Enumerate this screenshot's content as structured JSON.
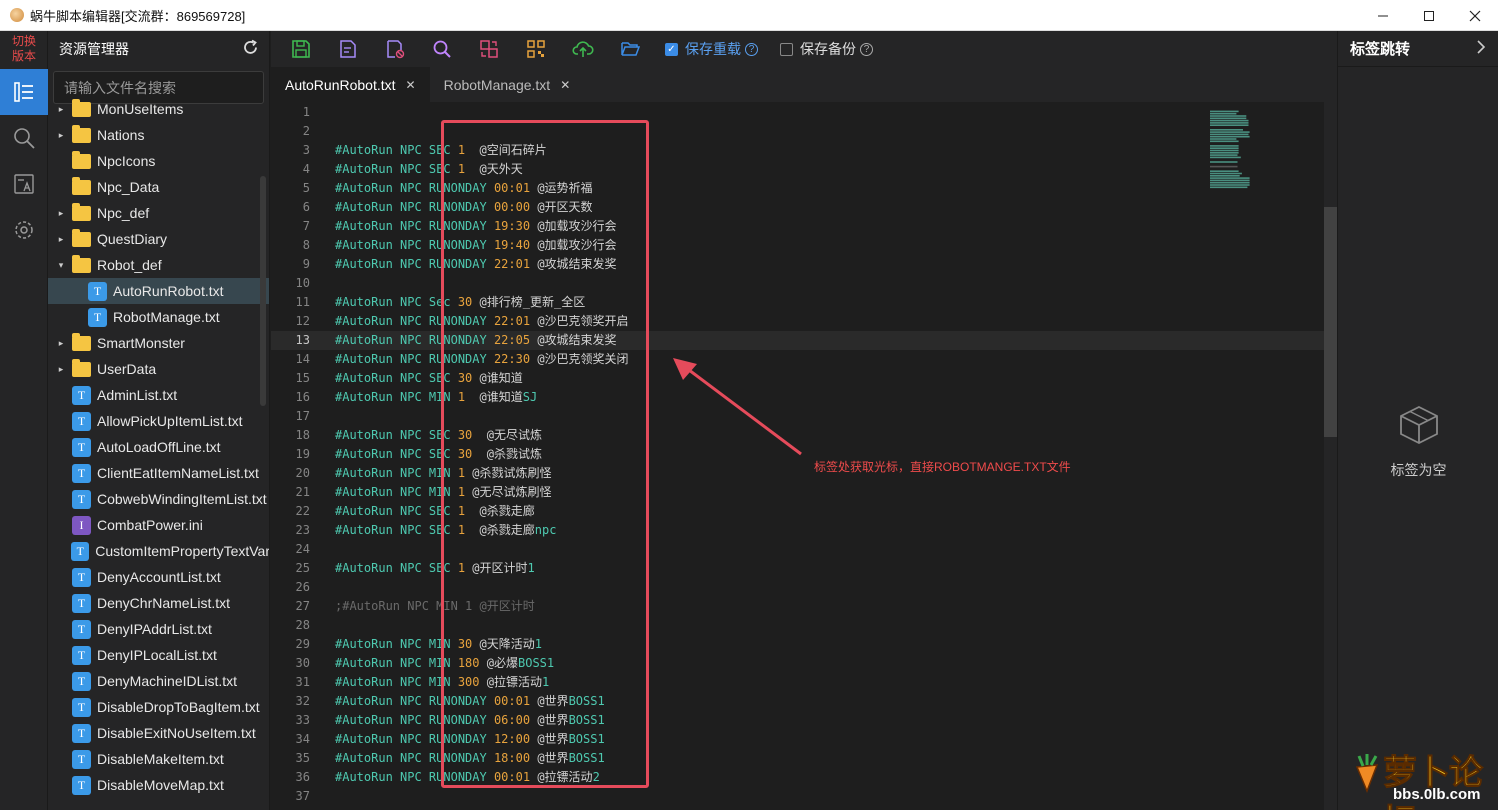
{
  "window": {
    "title": "蜗牛脚本编辑器[交流群：869569728]"
  },
  "activity": {
    "switch_version": "切换\n版本",
    "icons": [
      "explorer-icon",
      "search-icon",
      "font-replace-icon",
      "settings-icon"
    ]
  },
  "explorer": {
    "title": "资源管理器",
    "search_placeholder": "请输入文件名搜索",
    "items": [
      {
        "label": "MonUseItems",
        "type": "folder",
        "arrow": "▸",
        "depth": 0
      },
      {
        "label": "Nations",
        "type": "folder",
        "arrow": "▸",
        "depth": 0
      },
      {
        "label": "NpcIcons",
        "type": "folder",
        "arrow": "",
        "depth": 0
      },
      {
        "label": "Npc_Data",
        "type": "folder",
        "arrow": "",
        "depth": 0
      },
      {
        "label": "Npc_def",
        "type": "folder",
        "arrow": "▸",
        "depth": 0
      },
      {
        "label": "QuestDiary",
        "type": "folder",
        "arrow": "▸",
        "depth": 0
      },
      {
        "label": "Robot_def",
        "type": "folder",
        "arrow": "▾",
        "depth": 0
      },
      {
        "label": "AutoRunRobot.txt",
        "type": "txt",
        "arrow": "",
        "depth": 1,
        "selected": true
      },
      {
        "label": "RobotManage.txt",
        "type": "txt",
        "arrow": "",
        "depth": 1
      },
      {
        "label": "SmartMonster",
        "type": "folder",
        "arrow": "▸",
        "depth": 0
      },
      {
        "label": "UserData",
        "type": "folder",
        "arrow": "▸",
        "depth": 0
      },
      {
        "label": "AdminList.txt",
        "type": "txt",
        "arrow": "",
        "depth": 0
      },
      {
        "label": "AllowPickUpItemList.txt",
        "type": "txt",
        "arrow": "",
        "depth": 0
      },
      {
        "label": "AutoLoadOffLine.txt",
        "type": "txt",
        "arrow": "",
        "depth": 0
      },
      {
        "label": "ClientEatItemNameList.txt",
        "type": "txt",
        "arrow": "",
        "depth": 0
      },
      {
        "label": "CobwebWindingItemList.txt",
        "type": "txt",
        "arrow": "",
        "depth": 0
      },
      {
        "label": "CombatPower.ini",
        "type": "ini",
        "arrow": "",
        "depth": 0
      },
      {
        "label": "CustomItemPropertyTextVar",
        "type": "txt",
        "arrow": "",
        "depth": 0
      },
      {
        "label": "DenyAccountList.txt",
        "type": "txt",
        "arrow": "",
        "depth": 0
      },
      {
        "label": "DenyChrNameList.txt",
        "type": "txt",
        "arrow": "",
        "depth": 0
      },
      {
        "label": "DenyIPAddrList.txt",
        "type": "txt",
        "arrow": "",
        "depth": 0
      },
      {
        "label": "DenyIPLocalList.txt",
        "type": "txt",
        "arrow": "",
        "depth": 0
      },
      {
        "label": "DenyMachineIDList.txt",
        "type": "txt",
        "arrow": "",
        "depth": 0
      },
      {
        "label": "DisableDropToBagItem.txt",
        "type": "txt",
        "arrow": "",
        "depth": 0
      },
      {
        "label": "DisableExitNoUseItem.txt",
        "type": "txt",
        "arrow": "",
        "depth": 0
      },
      {
        "label": "DisableMakeItem.txt",
        "type": "txt",
        "arrow": "",
        "depth": 0
      },
      {
        "label": "DisableMoveMap.txt",
        "type": "txt",
        "arrow": "",
        "depth": 0
      }
    ]
  },
  "toolbar": {
    "buttons": [
      {
        "name": "save-icon",
        "color": "#3fb950"
      },
      {
        "name": "edit-file-icon",
        "color": "#a78bfa"
      },
      {
        "name": "file-close-icon",
        "color": "#a78bfa"
      },
      {
        "name": "search-icon",
        "color": "#c084fc"
      },
      {
        "name": "replace-icon",
        "color": "#e04f7c"
      },
      {
        "name": "qr-code-icon",
        "color": "#e8a33d"
      },
      {
        "name": "cloud-upload-icon",
        "color": "#3fb950"
      },
      {
        "name": "folder-open-icon",
        "color": "#3b8ce6"
      }
    ],
    "save_reload": {
      "label": "保存重载",
      "checked": true
    },
    "save_backup": {
      "label": "保存备份",
      "checked": false
    }
  },
  "tabs": [
    {
      "label": "AutoRunRobot.txt",
      "active": true
    },
    {
      "label": "RobotManage.txt",
      "active": false
    }
  ],
  "editor": {
    "current_line": 13,
    "lines": [
      {
        "n": "1",
        "t": ""
      },
      {
        "n": "2",
        "t": ""
      },
      {
        "n": "3",
        "t": "#AutoRun NPC SEC 1  @空间石碎片"
      },
      {
        "n": "4",
        "t": "#AutoRun NPC SEC 1  @天外天"
      },
      {
        "n": "5",
        "t": "#AutoRun NPC RUNONDAY 00:01 @运势祈福"
      },
      {
        "n": "6",
        "t": "#AutoRun NPC RUNONDAY 00:00 @开区天数"
      },
      {
        "n": "7",
        "t": "#AutoRun NPC RUNONDAY 19:30 @加载攻沙行会"
      },
      {
        "n": "8",
        "t": "#AutoRun NPC RUNONDAY 19:40 @加载攻沙行会"
      },
      {
        "n": "9",
        "t": "#AutoRun NPC RUNONDAY 22:01 @攻城结束发奖"
      },
      {
        "n": "10",
        "t": ""
      },
      {
        "n": "11",
        "t": "#AutoRun NPC Sec 30 @排行榜_更新_全区"
      },
      {
        "n": "12",
        "t": "#AutoRun NPC RUNONDAY 22:01 @沙巴克领奖开启"
      },
      {
        "n": "13",
        "t": "#AutoRun NPC RUNONDAY 22:05 @攻城结束发奖"
      },
      {
        "n": "14",
        "t": "#AutoRun NPC RUNONDAY 22:30 @沙巴克领奖关闭"
      },
      {
        "n": "15",
        "t": "#AutoRun NPC SEC 30 @谁知道"
      },
      {
        "n": "16",
        "t": "#AutoRun NPC MIN 1  @谁知道SJ"
      },
      {
        "n": "17",
        "t": ""
      },
      {
        "n": "18",
        "t": "#AutoRun NPC SEC 30  @无尽试炼"
      },
      {
        "n": "19",
        "t": "#AutoRun NPC SEC 30  @杀戮试炼"
      },
      {
        "n": "20",
        "t": "#AutoRun NPC MIN 1 @杀戮试炼刷怪"
      },
      {
        "n": "21",
        "t": "#AutoRun NPC MIN 1 @无尽试炼刷怪"
      },
      {
        "n": "22",
        "t": "#AutoRun NPC SEC 1  @杀戮走廊"
      },
      {
        "n": "23",
        "t": "#AutoRun NPC SEC 1  @杀戮走廊npc"
      },
      {
        "n": "24",
        "t": ""
      },
      {
        "n": "25",
        "t": "#AutoRun NPC SEC 1 @开区计时1"
      },
      {
        "n": "26",
        "t": ""
      },
      {
        "n": "27",
        "t": ";#AutoRun NPC MIN 1 @开区计时"
      },
      {
        "n": "28",
        "t": ""
      },
      {
        "n": "29",
        "t": "#AutoRun NPC MIN 30 @天降活动1"
      },
      {
        "n": "30",
        "t": "#AutoRun NPC MIN 180 @必爆BOSS1"
      },
      {
        "n": "31",
        "t": "#AutoRun NPC MIN 300 @拉镖活动1"
      },
      {
        "n": "32",
        "t": "#AutoRun NPC RUNONDAY 00:01 @世界BOSS1"
      },
      {
        "n": "33",
        "t": "#AutoRun NPC RUNONDAY 06:00 @世界BOSS1"
      },
      {
        "n": "34",
        "t": "#AutoRun NPC RUNONDAY 12:00 @世界BOSS1"
      },
      {
        "n": "35",
        "t": "#AutoRun NPC RUNONDAY 18:00 @世界BOSS1"
      },
      {
        "n": "36",
        "t": "#AutoRun NPC RUNONDAY 00:01 @拉镖活动2"
      },
      {
        "n": "37",
        "t": ""
      }
    ],
    "annotation": "标签处获取光标，直接ROBOTMANGE.TXT文件"
  },
  "right_panel": {
    "title": "标签跳转",
    "empty_label": "标签为空"
  },
  "watermark": {
    "text": "萝卜论坛",
    "url": "bbs.0lb.com"
  },
  "colors": {
    "accent": "#3b8ce6",
    "highlight": "#e54b5b",
    "keyword": "#4ec9b0",
    "number": "#e8a33d"
  }
}
